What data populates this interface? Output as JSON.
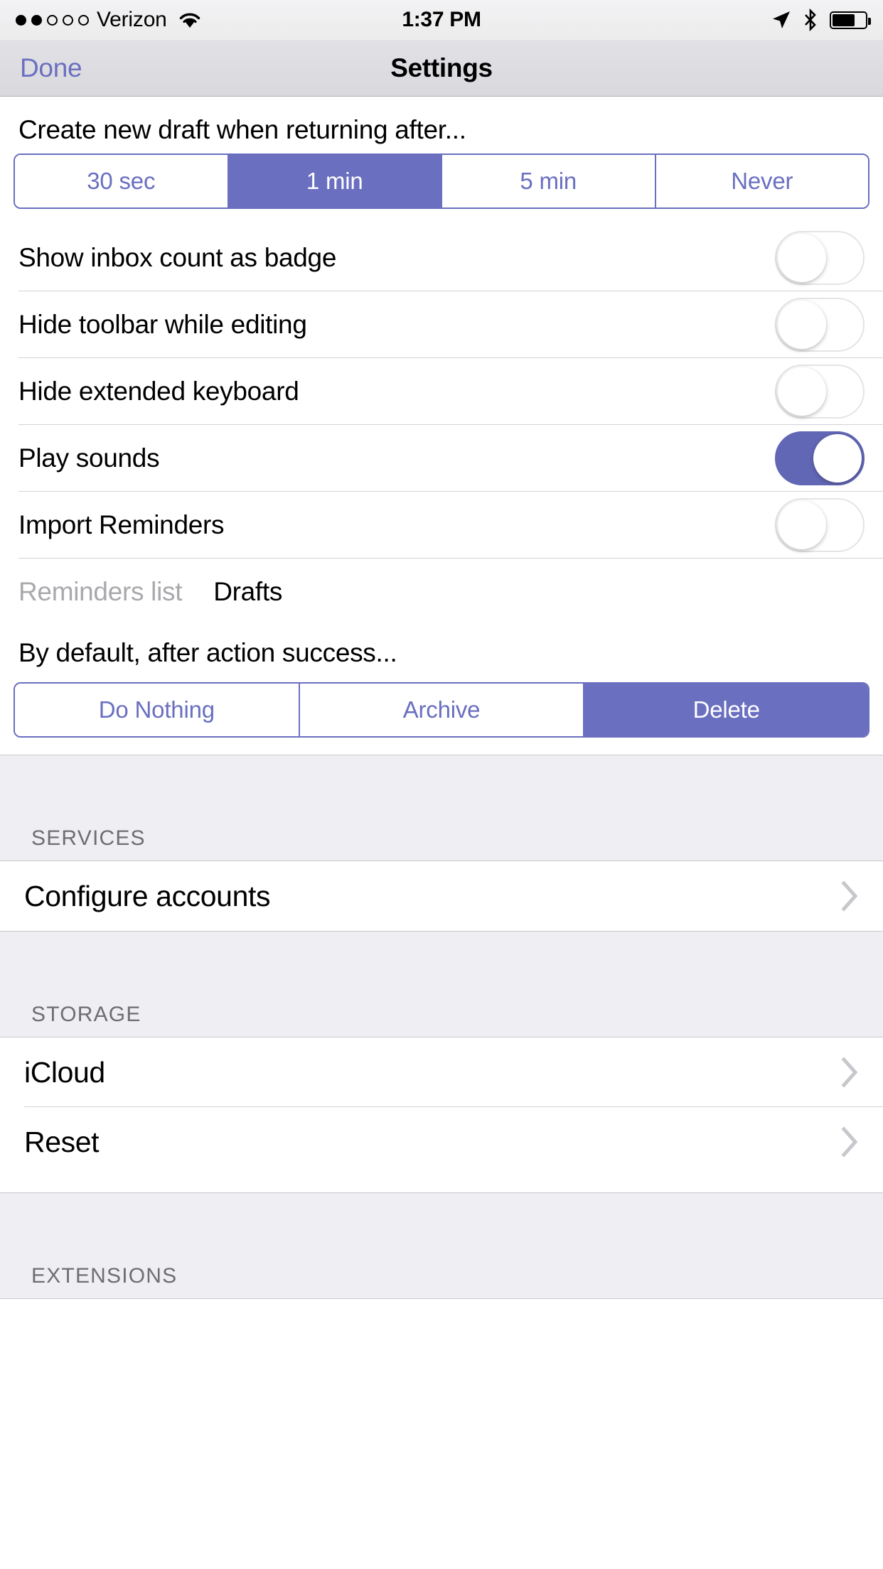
{
  "statusbar": {
    "signal_filled": 2,
    "signal_total": 5,
    "carrier": "Verizon",
    "wifi_icon": "wifi-icon",
    "time": "1:37 PM",
    "location_icon": "location-arrow-icon",
    "bluetooth_icon": "bluetooth-icon",
    "battery_icon": "battery-icon",
    "battery_percent": 68
  },
  "navbar": {
    "done_label": "Done",
    "title": "Settings"
  },
  "colors": {
    "accent": "#6a6fc0",
    "switch_on": "#6166b5",
    "group_bg": "#efeff3",
    "muted_text": "#a9a9ad",
    "header_text": "#6d6d72"
  },
  "draft_section": {
    "caption": "Create new draft when returning after...",
    "options": [
      "30 sec",
      "1 min",
      "5 min",
      "Never"
    ],
    "selected": "1 min"
  },
  "toggles": [
    {
      "label": "Show inbox count as badge",
      "state": "off"
    },
    {
      "label": "Hide toolbar while editing",
      "state": "off"
    },
    {
      "label": "Hide extended keyboard",
      "state": "off"
    },
    {
      "label": "Play sounds",
      "state": "on"
    },
    {
      "label": "Import Reminders",
      "state": "off"
    }
  ],
  "reminders_row": {
    "label": "Reminders list",
    "value": "Drafts"
  },
  "action_section": {
    "caption": "By default, after action success...",
    "options": [
      "Do Nothing",
      "Archive",
      "Delete"
    ],
    "selected": "Delete"
  },
  "services": {
    "header": "SERVICES",
    "rows": [
      {
        "label": "Configure accounts",
        "accessory": "chevron-right-icon"
      }
    ]
  },
  "storage": {
    "header": "STORAGE",
    "rows": [
      {
        "label": "iCloud",
        "accessory": "chevron-right-icon"
      },
      {
        "label": "Reset",
        "accessory": "chevron-right-icon"
      }
    ]
  },
  "extensions": {
    "header": "EXTENSIONS"
  }
}
